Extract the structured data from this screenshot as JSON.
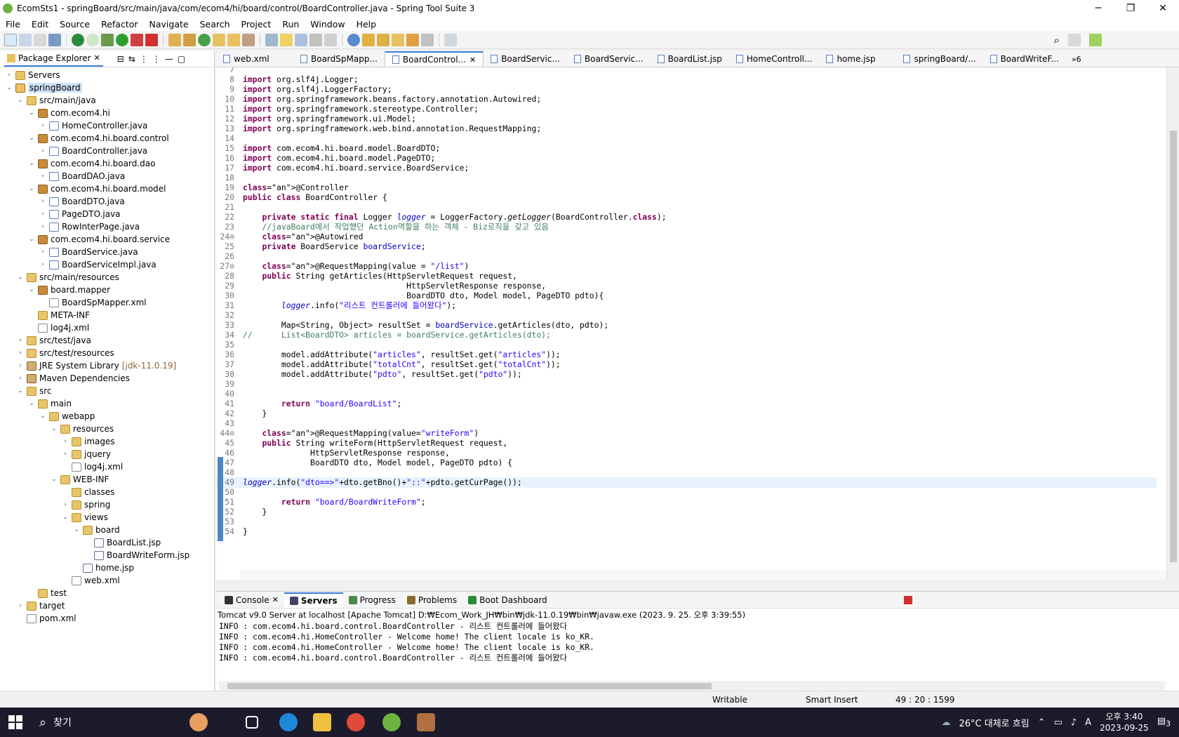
{
  "window": {
    "title": "EcomSts1 - springBoard/src/main/java/com/ecom4/hi/board/control/BoardController.java - Spring Tool Suite 3",
    "minimize": "─",
    "maximize": "❐",
    "close": "✕"
  },
  "menu": [
    "File",
    "Edit",
    "Source",
    "Refactor",
    "Navigate",
    "Search",
    "Project",
    "Run",
    "Window",
    "Help"
  ],
  "package_explorer": {
    "title": "Package Explorer",
    "tree": [
      {
        "label": "Servers",
        "depth": 0,
        "icon": "folder",
        "twisty": "›"
      },
      {
        "label": "springBoard",
        "depth": 0,
        "icon": "proj",
        "twisty": "⌄",
        "selected": true
      },
      {
        "label": "src/main/java",
        "depth": 1,
        "icon": "folder",
        "twisty": "⌄"
      },
      {
        "label": "com.ecom4.hi",
        "depth": 2,
        "icon": "pkg",
        "twisty": "⌄"
      },
      {
        "label": "HomeController.java",
        "depth": 3,
        "icon": "java",
        "twisty": "›"
      },
      {
        "label": "com.ecom4.hi.board.control",
        "depth": 2,
        "icon": "pkg",
        "twisty": "⌄"
      },
      {
        "label": "BoardController.java",
        "depth": 3,
        "icon": "java",
        "twisty": "›"
      },
      {
        "label": "com.ecom4.hi.board.dao",
        "depth": 2,
        "icon": "pkg",
        "twisty": "⌄"
      },
      {
        "label": "BoardDAO.java",
        "depth": 3,
        "icon": "java",
        "twisty": "›"
      },
      {
        "label": "com.ecom4.hi.board.model",
        "depth": 2,
        "icon": "pkg",
        "twisty": "⌄"
      },
      {
        "label": "BoardDTO.java",
        "depth": 3,
        "icon": "java",
        "twisty": "›"
      },
      {
        "label": "PageDTO.java",
        "depth": 3,
        "icon": "java",
        "twisty": "›"
      },
      {
        "label": "RowInterPage.java",
        "depth": 3,
        "icon": "java",
        "twisty": "›"
      },
      {
        "label": "com.ecom4.hi.board.service",
        "depth": 2,
        "icon": "pkg",
        "twisty": "⌄"
      },
      {
        "label": "BoardService.java",
        "depth": 3,
        "icon": "java",
        "twisty": "›"
      },
      {
        "label": "BoardServiceImpl.java",
        "depth": 3,
        "icon": "java",
        "twisty": "›"
      },
      {
        "label": "src/main/resources",
        "depth": 1,
        "icon": "folder",
        "twisty": "⌄"
      },
      {
        "label": "board.mapper",
        "depth": 2,
        "icon": "pkg",
        "twisty": "⌄"
      },
      {
        "label": "BoardSpMapper.xml",
        "depth": 3,
        "icon": "xml",
        "twisty": ""
      },
      {
        "label": "META-INF",
        "depth": 2,
        "icon": "folder",
        "twisty": ""
      },
      {
        "label": "log4j.xml",
        "depth": 2,
        "icon": "xml",
        "twisty": ""
      },
      {
        "label": "src/test/java",
        "depth": 1,
        "icon": "folder",
        "twisty": "›"
      },
      {
        "label": "src/test/resources",
        "depth": 1,
        "icon": "folder",
        "twisty": "›"
      },
      {
        "label": "JRE System Library",
        "extra": "[jdk-11.0.19]",
        "depth": 1,
        "icon": "lib",
        "twisty": "›"
      },
      {
        "label": "Maven Dependencies",
        "depth": 1,
        "icon": "lib",
        "twisty": "›"
      },
      {
        "label": "src",
        "depth": 1,
        "icon": "folder",
        "twisty": "⌄"
      },
      {
        "label": "main",
        "depth": 2,
        "icon": "folder",
        "twisty": "⌄"
      },
      {
        "label": "webapp",
        "depth": 3,
        "icon": "folder",
        "twisty": "⌄"
      },
      {
        "label": "resources",
        "depth": 4,
        "icon": "folder",
        "twisty": "⌄"
      },
      {
        "label": "images",
        "depth": 5,
        "icon": "folder",
        "twisty": "›"
      },
      {
        "label": "jquery",
        "depth": 5,
        "icon": "folder",
        "twisty": "›"
      },
      {
        "label": "log4j.xml",
        "depth": 5,
        "icon": "xml",
        "twisty": ""
      },
      {
        "label": "WEB-INF",
        "depth": 4,
        "icon": "folder",
        "twisty": "⌄"
      },
      {
        "label": "classes",
        "depth": 5,
        "icon": "folder",
        "twisty": ""
      },
      {
        "label": "spring",
        "depth": 5,
        "icon": "folder",
        "twisty": "›"
      },
      {
        "label": "views",
        "depth": 5,
        "icon": "folder",
        "twisty": "⌄"
      },
      {
        "label": "board",
        "depth": 6,
        "icon": "folder",
        "twisty": "⌄"
      },
      {
        "label": "BoardList.jsp",
        "depth": 7,
        "icon": "jsp",
        "twisty": ""
      },
      {
        "label": "BoardWriteForm.jsp",
        "depth": 7,
        "icon": "jsp",
        "twisty": ""
      },
      {
        "label": "home.jsp",
        "depth": 6,
        "icon": "jsp",
        "twisty": ""
      },
      {
        "label": "web.xml",
        "depth": 5,
        "icon": "xml",
        "twisty": ""
      },
      {
        "label": "test",
        "depth": 2,
        "icon": "folder",
        "twisty": ""
      },
      {
        "label": "target",
        "depth": 1,
        "icon": "folder",
        "twisty": "›"
      },
      {
        "label": "pom.xml",
        "depth": 1,
        "icon": "xml",
        "twisty": ""
      }
    ]
  },
  "editor_tabs": [
    {
      "label": "web.xml",
      "active": false
    },
    {
      "label": "BoardSpMapp...",
      "active": false
    },
    {
      "label": "BoardControl...",
      "active": true
    },
    {
      "label": "BoardServic...",
      "active": false
    },
    {
      "label": "BoardServic...",
      "active": false
    },
    {
      "label": "BoardList.jsp",
      "active": false
    },
    {
      "label": "HomeControll...",
      "active": false
    },
    {
      "label": "home.jsp",
      "active": false
    },
    {
      "label": "springBoard/...",
      "active": false
    },
    {
      "label": "BoardWriteF...",
      "active": false
    }
  ],
  "editor_overflow": "»6",
  "code": [
    {
      "n": "7",
      "t": ""
    },
    {
      "n": "8",
      "t": "import org.slf4j.Logger;"
    },
    {
      "n": "9",
      "t": "import org.slf4j.LoggerFactory;"
    },
    {
      "n": "10",
      "t": "import org.springframework.beans.factory.annotation.Autowired;"
    },
    {
      "n": "11",
      "t": "import org.springframework.stereotype.Controller;"
    },
    {
      "n": "12",
      "t": "import org.springframework.ui.Model;"
    },
    {
      "n": "13",
      "t": "import org.springframework.web.bind.annotation.RequestMapping;"
    },
    {
      "n": "14",
      "t": ""
    },
    {
      "n": "15",
      "t": "import com.ecom4.hi.board.model.BoardDTO;"
    },
    {
      "n": "16",
      "t": "import com.ecom4.hi.board.model.PageDTO;"
    },
    {
      "n": "17",
      "t": "import com.ecom4.hi.board.service.BoardService;"
    },
    {
      "n": "18",
      "t": ""
    },
    {
      "n": "19",
      "t": "@Controller"
    },
    {
      "n": "20",
      "t": "public class BoardController {"
    },
    {
      "n": "21",
      "t": ""
    },
    {
      "n": "22",
      "t": "    private static final Logger logger = LoggerFactory.getLogger(BoardController.class);"
    },
    {
      "n": "23",
      "t": "    //javaBoard에서 작업했던 Action역할을 하는 객체 - Biz로직을 갖고 있음"
    },
    {
      "n": "24⊖",
      "t": "    @Autowired"
    },
    {
      "n": "25",
      "t": "    private BoardService boardService;"
    },
    {
      "n": "26",
      "t": ""
    },
    {
      "n": "27⊖",
      "t": "    @RequestMapping(value = \"/list\")"
    },
    {
      "n": "28",
      "t": "    public String getArticles(HttpServletRequest request,"
    },
    {
      "n": "29",
      "t": "                                  HttpServletResponse response,"
    },
    {
      "n": "30",
      "t": "                                  BoardDTO dto, Model model, PageDTO pdto){"
    },
    {
      "n": "31",
      "t": "        logger.info(\"리스트 컨트롤러에 들어왔다\");"
    },
    {
      "n": "32",
      "t": ""
    },
    {
      "n": "33",
      "t": "        Map<String, Object> resultSet = boardService.getArticles(dto, pdto);"
    },
    {
      "n": "34",
      "t": "//      List<BoardDTO> articles = boardService.getArticles(dto);"
    },
    {
      "n": "35",
      "t": ""
    },
    {
      "n": "36",
      "t": "        model.addAttribute(\"articles\", resultSet.get(\"articles\"));"
    },
    {
      "n": "37",
      "t": "        model.addAttribute(\"totalCnt\", resultSet.get(\"totalCnt\"));"
    },
    {
      "n": "38",
      "t": "        model.addAttribute(\"pdto\", resultSet.get(\"pdto\"));"
    },
    {
      "n": "39",
      "t": ""
    },
    {
      "n": "40",
      "t": ""
    },
    {
      "n": "41",
      "t": "        return \"board/BoardList\";"
    },
    {
      "n": "42",
      "t": "    }"
    },
    {
      "n": "43",
      "t": ""
    },
    {
      "n": "44⊖",
      "t": "    @RequestMapping(value=\"writeForm\")"
    },
    {
      "n": "45",
      "t": "    public String writeForm(HttpServletRequest request,"
    },
    {
      "n": "46",
      "t": "              HttpServletResponse response,"
    },
    {
      "n": "47",
      "t": "              BoardDTO dto, Model model, PageDTO pdto) {"
    },
    {
      "n": "48",
      "t": ""
    },
    {
      "n": "49",
      "t": "logger.info(\"dto==>\"+dto.getBno()+\"::\"+pdto.getCurPage());",
      "hl": true
    },
    {
      "n": "50",
      "t": ""
    },
    {
      "n": "51",
      "t": "        return \"board/BoardWriteForm\";"
    },
    {
      "n": "52",
      "t": "    }"
    },
    {
      "n": "53",
      "t": ""
    },
    {
      "n": "54",
      "t": "}"
    }
  ],
  "console": {
    "tabs": [
      {
        "label": "Console",
        "active": false
      },
      {
        "label": "Servers",
        "active": true
      },
      {
        "label": "Progress",
        "active": false
      },
      {
        "label": "Problems",
        "active": false
      },
      {
        "label": "Boot Dashboard",
        "active": false
      }
    ],
    "header": "Tomcat v9.0 Server at localhost [Apache Tomcat] D:₩Ecom_Work_JH₩bin₩jdk-11.0.19₩bin₩javaw.exe  (2023. 9. 25. 오후 3:39:55)",
    "lines": [
      "INFO : com.ecom4.hi.board.control.BoardController - 리스트 컨트롤러에 들어왔다",
      "INFO : com.ecom4.hi.HomeController - Welcome home! The client locale is ko_KR.",
      "INFO : com.ecom4.hi.HomeController - Welcome home! The client locale is ko_KR.",
      "INFO : com.ecom4.hi.board.control.BoardController - 리스트 컨트롤러에 들어왔다"
    ]
  },
  "status": {
    "writable": "Writable",
    "insert_mode": "Smart Insert",
    "position": "49 : 20 : 1599"
  },
  "taskbar": {
    "search_label": "찾기",
    "weather": "26°C  대체로 흐림",
    "time": "오후 3:40",
    "date": "2023-09-25",
    "ime": "A",
    "notif_count": "3"
  },
  "colors": {
    "accent": "#3d7bd6",
    "keyword": "#7f0055",
    "string": "#2a00ff",
    "comment": "#3f7f5f"
  }
}
